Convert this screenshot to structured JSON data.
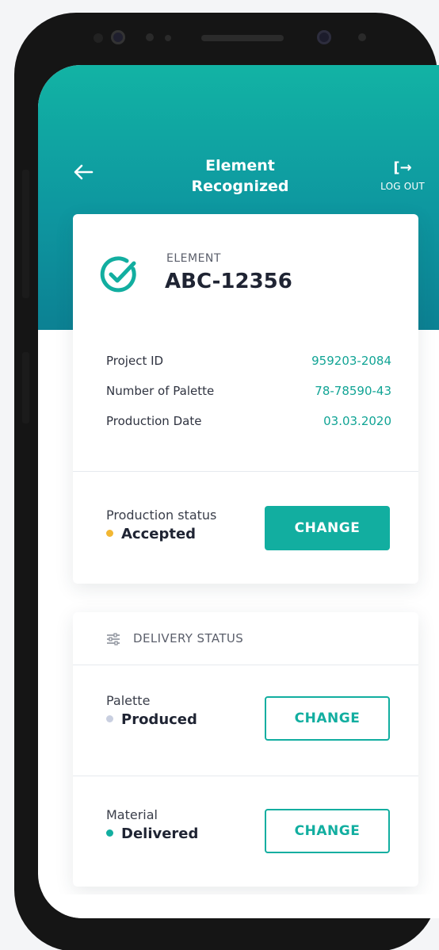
{
  "header": {
    "title": "Element Recognized",
    "back_icon": "arrow-left-icon",
    "logout_icon": "logout-icon",
    "logout_glyph": "[→",
    "logout_label": "LOG OUT"
  },
  "element": {
    "kicker": "ELEMENT",
    "code": "ABC-12356",
    "status_icon": "check-circle-icon"
  },
  "details": [
    {
      "label": "Project ID",
      "value": "959203-2084"
    },
    {
      "label": "Number of Palette",
      "value": "78-78590-43"
    },
    {
      "label": "Production Date",
      "value": "03.03.2020"
    }
  ],
  "production": {
    "label": "Production status",
    "value": "Accepted",
    "dot_color": "#f2b733",
    "button_label": "CHANGE"
  },
  "delivery": {
    "section_title": "DELIVERY STATUS",
    "section_icon": "sliders-icon",
    "items": [
      {
        "label": "Palette",
        "value": "Produced",
        "dot_color": "#c9cfe0",
        "button_label": "CHANGE"
      },
      {
        "label": "Material",
        "value": "Delivered",
        "dot_color": "#12aea0",
        "button_label": "CHANGE"
      }
    ]
  },
  "colors": {
    "accent": "#12aea0",
    "header_top": "#12b3a4",
    "header_bottom": "#0c8193"
  }
}
